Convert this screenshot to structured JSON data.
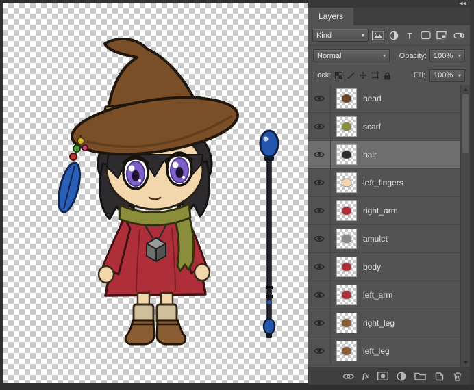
{
  "panel": {
    "tab_label": "Layers",
    "icons": {
      "collapse_glyph": "◀◀",
      "dropdown_arrow": "▾",
      "type_filter_glyph": "T",
      "fx_glyph": "fx"
    },
    "filter_row": {
      "kind_label": "Kind"
    },
    "blend_row": {
      "blend_mode": "Normal",
      "opacity_label": "Opacity:",
      "opacity_value": "100%"
    },
    "lock_row": {
      "label": "Lock:",
      "fill_label": "Fill:",
      "fill_value": "100%"
    },
    "layers": [
      {
        "name": "head",
        "visible": true,
        "selected": false,
        "thumb_color": "#6b4423"
      },
      {
        "name": "scarf",
        "visible": true,
        "selected": false,
        "thumb_color": "#8a8d39"
      },
      {
        "name": "hair",
        "visible": true,
        "selected": true,
        "thumb_color": "#2d2b2e"
      },
      {
        "name": "left_fingers",
        "visible": true,
        "selected": false,
        "thumb_color": "#f0d6ae"
      },
      {
        "name": "right_arm",
        "visible": true,
        "selected": false,
        "thumb_color": "#ae2f3a"
      },
      {
        "name": "amulet",
        "visible": true,
        "selected": false,
        "thumb_color": "#8a8a8a"
      },
      {
        "name": "body",
        "visible": true,
        "selected": false,
        "thumb_color": "#ae2f3a"
      },
      {
        "name": "left_arm",
        "visible": true,
        "selected": false,
        "thumb_color": "#ae2f3a"
      },
      {
        "name": "right_leg",
        "visible": true,
        "selected": false,
        "thumb_color": "#8a5c33"
      },
      {
        "name": "left_leg",
        "visible": true,
        "selected": false,
        "thumb_color": "#8a5c33"
      }
    ],
    "footer": {
      "fx_label": "fx"
    }
  },
  "canvas": {
    "palette": {
      "hat": "#7a4e26",
      "hat_band": "#99962f",
      "hair": "#2d2b2e",
      "skin": "#f2d7ad",
      "eyes": "#7e5fc7",
      "dress": "#ae2f3a",
      "scarf": "#8a8d39",
      "boots": "#8a5c33",
      "staff_orb": "#2456ae",
      "checker_light": "#ffffff",
      "checker_dark": "#cbcbcb"
    }
  }
}
